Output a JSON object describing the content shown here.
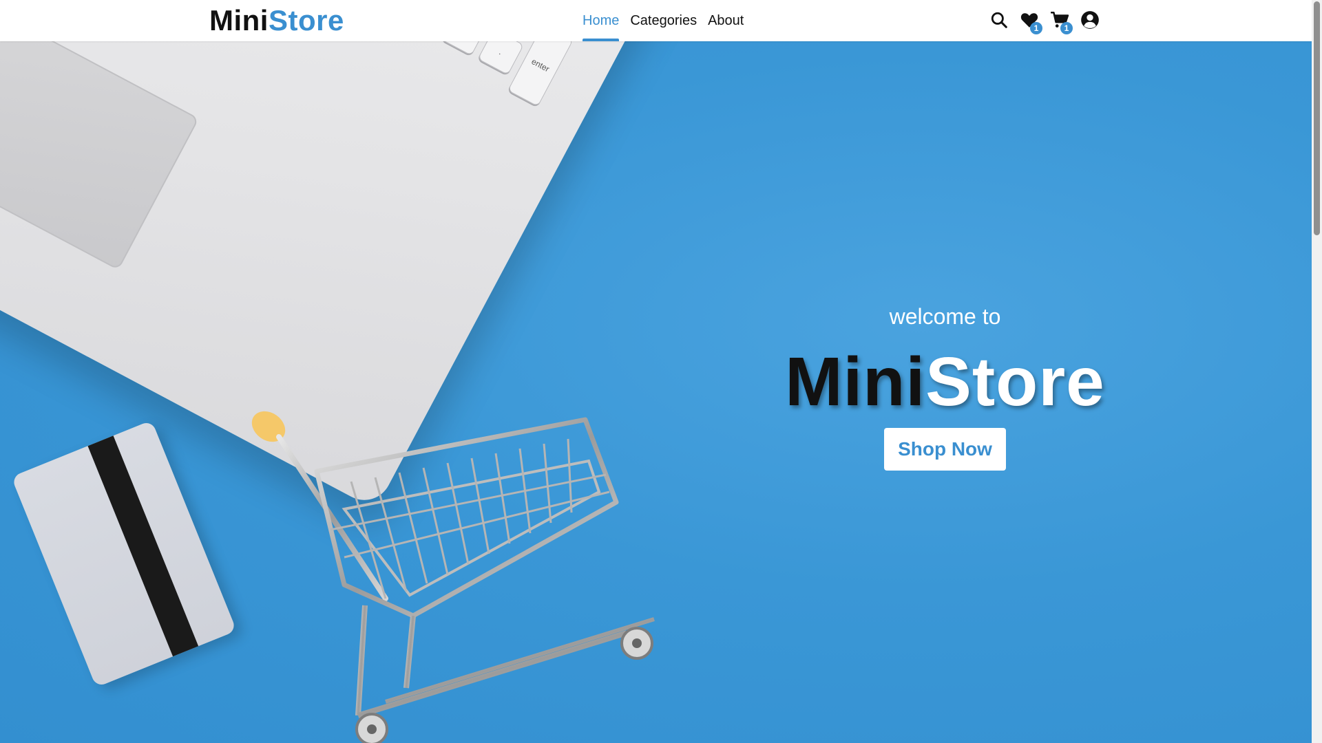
{
  "brand": {
    "part1": "Mini",
    "part2": "Store"
  },
  "nav": {
    "links": [
      {
        "label": "Home",
        "active": true
      },
      {
        "label": "Categories",
        "active": false
      },
      {
        "label": "About",
        "active": false
      }
    ],
    "icons": {
      "search": "search-icon",
      "wishlist": "heart-icon",
      "wishlist_count": "1",
      "cart": "cart-icon",
      "cart_count": "1",
      "account": "user-circle-icon"
    }
  },
  "hero": {
    "welcome": "welcome to",
    "title_part1": "Mini",
    "title_part2": "Store",
    "cta_label": "Shop Now"
  },
  "colors": {
    "accent": "#3a8fd0",
    "hero_bg": "#3a97d6",
    "nav_bg": "#ffffff",
    "text_dark": "#111111"
  }
}
